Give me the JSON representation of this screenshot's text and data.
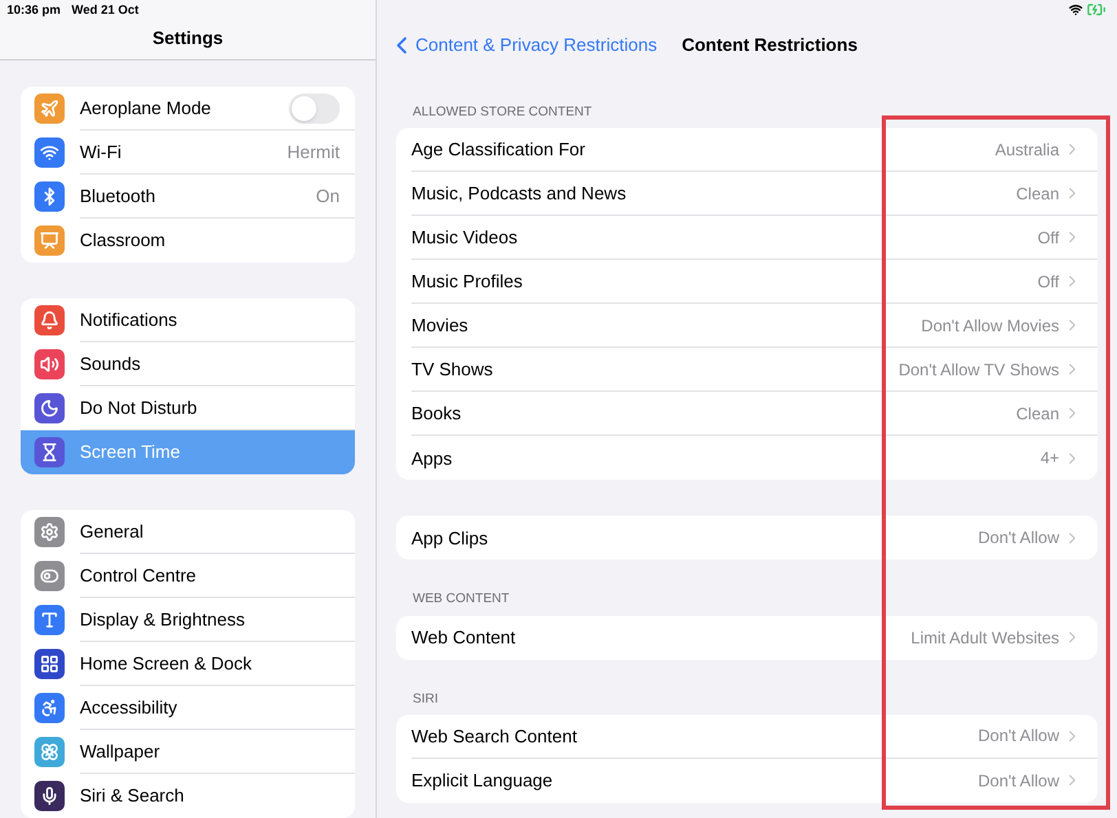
{
  "status_bar": {
    "time": "10:36 pm",
    "date": "Wed 21 Oct"
  },
  "sidebar": {
    "title": "Settings",
    "groups": [
      {
        "items": [
          {
            "label": "Aeroplane Mode",
            "kind": "toggle",
            "on": false,
            "selected": false,
            "color": "#f09a37"
          },
          {
            "label": "Wi-Fi",
            "kind": "value",
            "value": "Hermit",
            "selected": false,
            "color": "#3478f6"
          },
          {
            "label": "Bluetooth",
            "kind": "value",
            "value": "On",
            "selected": false,
            "color": "#3478f6"
          },
          {
            "label": "Classroom",
            "kind": "plain",
            "selected": false,
            "color": "#f09a37"
          }
        ]
      },
      {
        "items": [
          {
            "label": "Notifications",
            "kind": "plain",
            "selected": false,
            "color": "#eb4d3d"
          },
          {
            "label": "Sounds",
            "kind": "plain",
            "selected": false,
            "color": "#eb445a"
          },
          {
            "label": "Do Not Disturb",
            "kind": "plain",
            "selected": false,
            "color": "#5856d6"
          },
          {
            "label": "Screen Time",
            "kind": "plain",
            "selected": true,
            "color": "#5856d6"
          }
        ]
      },
      {
        "items": [
          {
            "label": "General",
            "kind": "plain",
            "selected": false,
            "color": "#8e8e93"
          },
          {
            "label": "Control Centre",
            "kind": "plain",
            "selected": false,
            "color": "#8e8e93"
          },
          {
            "label": "Display & Brightness",
            "kind": "plain",
            "selected": false,
            "color": "#3478f6"
          },
          {
            "label": "Home Screen & Dock",
            "kind": "plain",
            "selected": false,
            "color": "#2f48c9"
          },
          {
            "label": "Accessibility",
            "kind": "plain",
            "selected": false,
            "color": "#3478f6"
          },
          {
            "label": "Wallpaper",
            "kind": "plain",
            "selected": false,
            "color": "#3fa9d9"
          },
          {
            "label": "Siri & Search",
            "kind": "plain",
            "selected": false,
            "color": "#3a2a5e"
          }
        ]
      }
    ]
  },
  "detail": {
    "back_label": "Content & Privacy Restrictions",
    "title": "Content Restrictions",
    "sections": [
      {
        "header": "ALLOWED STORE CONTENT",
        "rows": [
          {
            "label": "Age Classification For",
            "value": "Australia"
          },
          {
            "label": "Music, Podcasts and News",
            "value": "Clean"
          },
          {
            "label": "Music Videos",
            "value": "Off"
          },
          {
            "label": "Music Profiles",
            "value": "Off"
          },
          {
            "label": "Movies",
            "value": "Don't Allow Movies"
          },
          {
            "label": "TV Shows",
            "value": "Don't Allow TV Shows"
          },
          {
            "label": "Books",
            "value": "Clean"
          },
          {
            "label": "Apps",
            "value": "4+"
          }
        ]
      },
      {
        "rows": [
          {
            "label": "App Clips",
            "value": "Don't Allow"
          }
        ]
      },
      {
        "header": "WEB CONTENT",
        "rows": [
          {
            "label": "Web Content",
            "value": "Limit Adult Websites"
          }
        ]
      },
      {
        "header": "SIRI",
        "rows": [
          {
            "label": "Web Search Content",
            "value": "Don't Allow"
          },
          {
            "label": "Explicit Language",
            "value": "Don't Allow"
          }
        ]
      }
    ]
  }
}
